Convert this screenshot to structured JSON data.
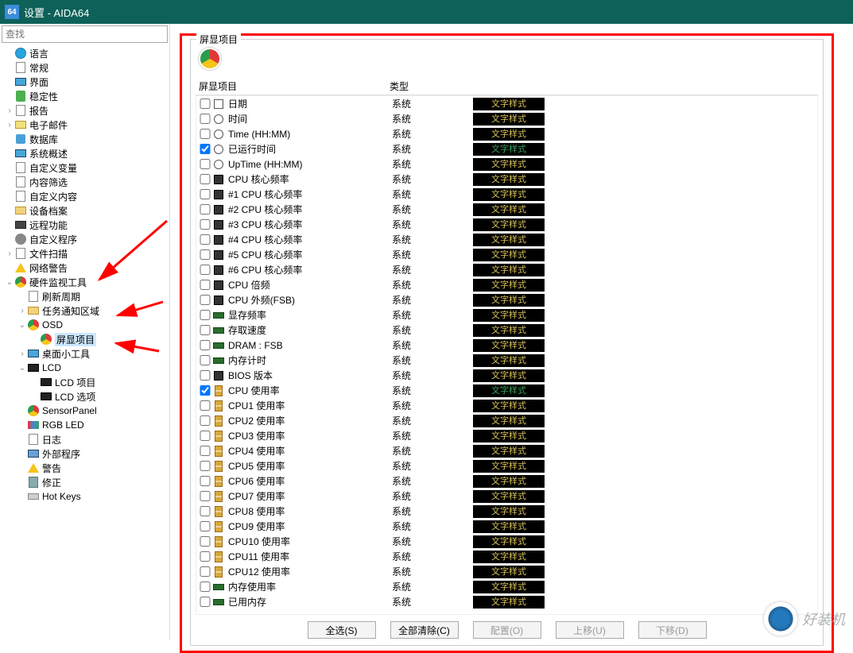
{
  "app_icon_text": "64",
  "window_title": "设置 - AIDA64",
  "search_placeholder": "查找",
  "tree": [
    {
      "label": "语言",
      "icon": "ic-globe",
      "ind": 0,
      "exp": ""
    },
    {
      "label": "常规",
      "icon": "ic-sheet",
      "ind": 0,
      "exp": ""
    },
    {
      "label": "界面",
      "icon": "ic-monitor",
      "ind": 0,
      "exp": ""
    },
    {
      "label": "稳定性",
      "icon": "ic-shield",
      "ind": 0,
      "exp": ""
    },
    {
      "label": "报告",
      "icon": "ic-sheet",
      "ind": 0,
      "exp": ">"
    },
    {
      "label": "电子邮件",
      "icon": "ic-mail",
      "ind": 0,
      "exp": ">"
    },
    {
      "label": "数据库",
      "icon": "ic-db",
      "ind": 0,
      "exp": ""
    },
    {
      "label": "系统概述",
      "icon": "ic-monitor",
      "ind": 0,
      "exp": ""
    },
    {
      "label": "自定义变量",
      "icon": "ic-sheet",
      "ind": 0,
      "exp": ""
    },
    {
      "label": "内容筛选",
      "icon": "ic-sheet",
      "ind": 0,
      "exp": ""
    },
    {
      "label": "自定义内容",
      "icon": "ic-sheet",
      "ind": 0,
      "exp": ""
    },
    {
      "label": "设备档案",
      "icon": "ic-folder",
      "ind": 0,
      "exp": ""
    },
    {
      "label": "远程功能",
      "icon": "ic-cam",
      "ind": 0,
      "exp": ""
    },
    {
      "label": "自定义程序",
      "icon": "ic-gear",
      "ind": 0,
      "exp": ""
    },
    {
      "label": "文件扫描",
      "icon": "ic-sheet",
      "ind": 0,
      "exp": ">"
    },
    {
      "label": "网络警告",
      "icon": "ic-warn",
      "ind": 0,
      "exp": ""
    },
    {
      "label": "硬件监视工具",
      "icon": "ic-eye",
      "ind": 0,
      "exp": "v"
    },
    {
      "label": "刷新周期",
      "icon": "ic-sheet",
      "ind": 1,
      "exp": ""
    },
    {
      "label": "任务通知区域",
      "icon": "ic-folder",
      "ind": 1,
      "exp": ">"
    },
    {
      "label": "OSD",
      "icon": "ic-eye",
      "ind": 1,
      "exp": "v"
    },
    {
      "label": "屏显项目",
      "icon": "ic-eye",
      "ind": 2,
      "exp": "",
      "selected": true
    },
    {
      "label": "桌面小工具",
      "icon": "ic-monitor",
      "ind": 1,
      "exp": ">"
    },
    {
      "label": "LCD",
      "icon": "ic-lcd",
      "ind": 1,
      "exp": "v"
    },
    {
      "label": "LCD 项目",
      "icon": "ic-lcd",
      "ind": 2,
      "exp": ""
    },
    {
      "label": "LCD 选项",
      "icon": "ic-lcd",
      "ind": 2,
      "exp": ""
    },
    {
      "label": "SensorPanel",
      "icon": "ic-eye",
      "ind": 1,
      "exp": ""
    },
    {
      "label": "RGB LED",
      "icon": "ic-rgb",
      "ind": 1,
      "exp": ""
    },
    {
      "label": "日志",
      "icon": "ic-log",
      "ind": 1,
      "exp": ""
    },
    {
      "label": "外部程序",
      "icon": "ic-ext",
      "ind": 1,
      "exp": ""
    },
    {
      "label": "警告",
      "icon": "ic-warn",
      "ind": 1,
      "exp": ""
    },
    {
      "label": "修正",
      "icon": "ic-fix",
      "ind": 1,
      "exp": ""
    },
    {
      "label": "Hot Keys",
      "icon": "ic-key",
      "ind": 1,
      "exp": ""
    }
  ],
  "group_title": "屏显项目",
  "columns": {
    "c1": "屏显项目",
    "c2": "类型",
    "c3": ""
  },
  "rows": [
    {
      "chk": false,
      "icon": "ic-cal",
      "label": "日期",
      "type": "系统",
      "style": "yellow"
    },
    {
      "chk": false,
      "icon": "ic-clock",
      "label": "时间",
      "type": "系统",
      "style": "yellow"
    },
    {
      "chk": false,
      "icon": "ic-clock",
      "label": "Time (HH:MM)",
      "type": "系统",
      "style": "yellow"
    },
    {
      "chk": true,
      "icon": "ic-clock",
      "label": "已运行时间",
      "type": "系统",
      "style": "green"
    },
    {
      "chk": false,
      "icon": "ic-clock",
      "label": "UpTime (HH:MM)",
      "type": "系统",
      "style": "yellow"
    },
    {
      "chk": false,
      "icon": "ic-cpu",
      "label": "CPU 核心频率",
      "type": "系统",
      "style": "yellow"
    },
    {
      "chk": false,
      "icon": "ic-cpu",
      "label": "#1 CPU 核心频率",
      "type": "系统",
      "style": "yellow"
    },
    {
      "chk": false,
      "icon": "ic-cpu",
      "label": "#2 CPU 核心频率",
      "type": "系统",
      "style": "yellow"
    },
    {
      "chk": false,
      "icon": "ic-cpu",
      "label": "#3 CPU 核心频率",
      "type": "系统",
      "style": "yellow"
    },
    {
      "chk": false,
      "icon": "ic-cpu",
      "label": "#4 CPU 核心频率",
      "type": "系统",
      "style": "yellow"
    },
    {
      "chk": false,
      "icon": "ic-cpu",
      "label": "#5 CPU 核心频率",
      "type": "系统",
      "style": "yellow"
    },
    {
      "chk": false,
      "icon": "ic-cpu",
      "label": "#6 CPU 核心频率",
      "type": "系统",
      "style": "yellow"
    },
    {
      "chk": false,
      "icon": "ic-cpu",
      "label": "CPU 倍频",
      "type": "系统",
      "style": "yellow"
    },
    {
      "chk": false,
      "icon": "ic-cpu",
      "label": "CPU 外频(FSB)",
      "type": "系统",
      "style": "yellow"
    },
    {
      "chk": false,
      "icon": "ic-ram",
      "label": "显存频率",
      "type": "系统",
      "style": "yellow"
    },
    {
      "chk": false,
      "icon": "ic-ram",
      "label": "存取速度",
      "type": "系统",
      "style": "yellow"
    },
    {
      "chk": false,
      "icon": "ic-ram",
      "label": "DRAM : FSB",
      "type": "系统",
      "style": "yellow"
    },
    {
      "chk": false,
      "icon": "ic-ram",
      "label": "内存计时",
      "type": "系统",
      "style": "yellow"
    },
    {
      "chk": false,
      "icon": "ic-cpu",
      "label": "BIOS 版本",
      "type": "系统",
      "style": "yellow"
    },
    {
      "chk": true,
      "icon": "ic-hour",
      "label": "CPU 使用率",
      "type": "系统",
      "style": "green"
    },
    {
      "chk": false,
      "icon": "ic-hour",
      "label": "CPU1 使用率",
      "type": "系统",
      "style": "yellow"
    },
    {
      "chk": false,
      "icon": "ic-hour",
      "label": "CPU2 使用率",
      "type": "系统",
      "style": "yellow"
    },
    {
      "chk": false,
      "icon": "ic-hour",
      "label": "CPU3 使用率",
      "type": "系统",
      "style": "yellow"
    },
    {
      "chk": false,
      "icon": "ic-hour",
      "label": "CPU4 使用率",
      "type": "系统",
      "style": "yellow"
    },
    {
      "chk": false,
      "icon": "ic-hour",
      "label": "CPU5 使用率",
      "type": "系统",
      "style": "yellow"
    },
    {
      "chk": false,
      "icon": "ic-hour",
      "label": "CPU6 使用率",
      "type": "系统",
      "style": "yellow"
    },
    {
      "chk": false,
      "icon": "ic-hour",
      "label": "CPU7 使用率",
      "type": "系统",
      "style": "yellow"
    },
    {
      "chk": false,
      "icon": "ic-hour",
      "label": "CPU8 使用率",
      "type": "系统",
      "style": "yellow"
    },
    {
      "chk": false,
      "icon": "ic-hour",
      "label": "CPU9 使用率",
      "type": "系统",
      "style": "yellow"
    },
    {
      "chk": false,
      "icon": "ic-hour",
      "label": "CPU10 使用率",
      "type": "系统",
      "style": "yellow"
    },
    {
      "chk": false,
      "icon": "ic-hour",
      "label": "CPU11 使用率",
      "type": "系统",
      "style": "yellow"
    },
    {
      "chk": false,
      "icon": "ic-hour",
      "label": "CPU12 使用率",
      "type": "系统",
      "style": "yellow"
    },
    {
      "chk": false,
      "icon": "ic-ram",
      "label": "内存使用率",
      "type": "系统",
      "style": "yellow"
    },
    {
      "chk": false,
      "icon": "ic-ram",
      "label": "已用内存",
      "type": "系统",
      "style": "yellow"
    }
  ],
  "style_label": "文字样式",
  "buttons": {
    "select_all": "全选(S)",
    "clear_all": "全部清除(C)",
    "config": "配置(O)",
    "move_up": "上移(U)",
    "move_down": "下移(D)"
  },
  "watermark_text": "好装机"
}
